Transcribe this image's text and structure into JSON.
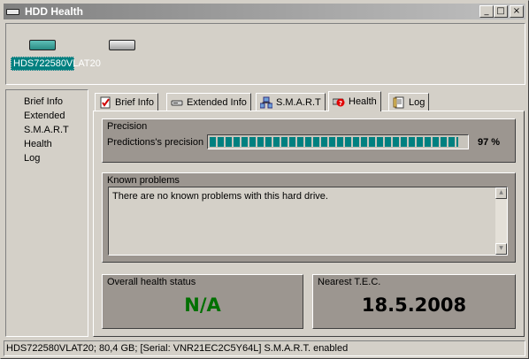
{
  "window": {
    "title": "HDD Health"
  },
  "titlebar_buttons": {
    "minimize": "_",
    "maximize": "□",
    "close": "×"
  },
  "drives": [
    {
      "label": "HDS722580VLAT20",
      "selected": true,
      "icon": "hdd-icon",
      "color": "#2a8c84"
    },
    {
      "label": "",
      "selected": false,
      "icon": "hdd-icon",
      "color": "#c0c0c0"
    }
  ],
  "sidebar": {
    "items": [
      {
        "label": "Brief Info"
      },
      {
        "label": "Extended"
      },
      {
        "label": "S.M.A.R.T"
      },
      {
        "label": "Health"
      },
      {
        "label": "Log"
      }
    ]
  },
  "tabs": [
    {
      "label": "Brief Info",
      "icon": "checklist-icon",
      "active": false
    },
    {
      "label": "Extended Info",
      "icon": "disk-icon",
      "active": false
    },
    {
      "label": "S.M.A.R.T",
      "icon": "network-icon",
      "active": false
    },
    {
      "label": "Health",
      "icon": "health-icon",
      "active": true
    },
    {
      "label": "Log",
      "icon": "log-icon",
      "active": false
    }
  ],
  "precision": {
    "title": "Precision",
    "label": "Predictions's precision",
    "value_text": "97 %",
    "value": 0.97
  },
  "known_problems": {
    "title": "Known problems",
    "text": "There are no known problems with this hard drive."
  },
  "overall_health": {
    "title": "Overall health status",
    "value": "N/A",
    "color": "#007000"
  },
  "nearest_tec": {
    "title": "Nearest T.E.C.",
    "value": "18.5.2008"
  },
  "statusbar": {
    "text": "HDS722580VLAT20;  80,4 GB;  [Serial: VNR21EC2C5Y64L]   S.M.A.R.T. enabled"
  }
}
